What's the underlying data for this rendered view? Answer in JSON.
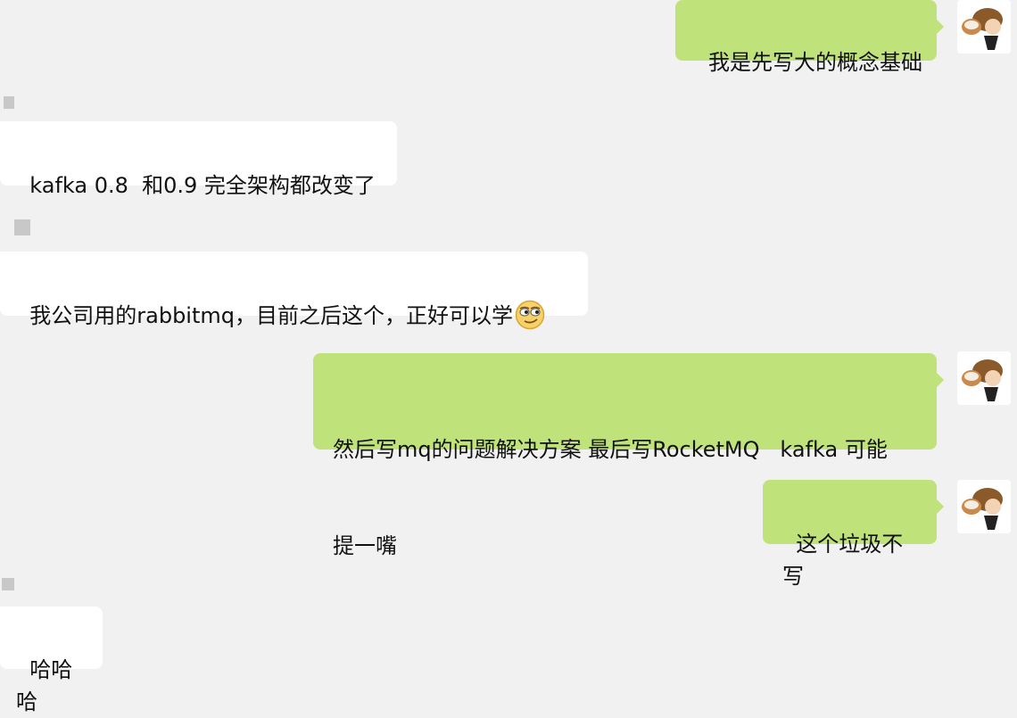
{
  "chat": {
    "messages": [
      {
        "id": "m1",
        "side": "outgoing",
        "text": "我是先写大的概念基础"
      },
      {
        "id": "m2",
        "side": "incoming",
        "text": "kafka 0.8  和0.9 完全架构都改变了"
      },
      {
        "id": "m3",
        "side": "incoming",
        "text": "我公司用的rabbitmq，目前之后这个，正好可以学",
        "emoji": "smirk-face-icon"
      },
      {
        "id": "m4",
        "side": "outgoing",
        "line1": "然后写mq的问题解决方案 最后写RocketMQ   kafka 可能",
        "line2": "提一嘴"
      },
      {
        "id": "m5",
        "side": "outgoing",
        "text": "这个垃圾不写"
      },
      {
        "id": "m6",
        "side": "incoming",
        "text": "哈哈哈"
      }
    ]
  },
  "colors": {
    "background": "#f1f1f1",
    "incoming_bubble": "#ffffff",
    "outgoing_bubble": "#c0e27a"
  },
  "icons": {
    "avatar": "user-avatar-icon",
    "emoji": "smirk-face-icon"
  }
}
